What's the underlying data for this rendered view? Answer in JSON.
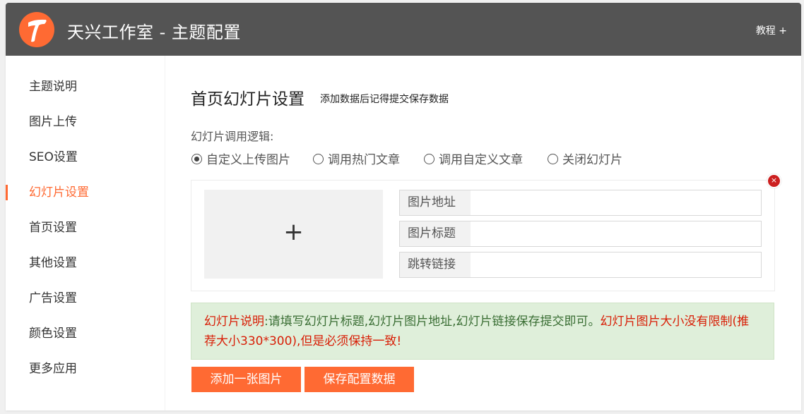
{
  "header": {
    "title": "天兴工作室 - 主题配置",
    "tutorial_label": "教程 +",
    "logo_color": "#ff6a33",
    "bar_color": "#545454"
  },
  "sidebar": {
    "items": [
      {
        "label": "主题说明",
        "active": false
      },
      {
        "label": "图片上传",
        "active": false
      },
      {
        "label": "SEO设置",
        "active": false
      },
      {
        "label": "幻灯片设置",
        "active": true
      },
      {
        "label": "首页设置",
        "active": false
      },
      {
        "label": "其他设置",
        "active": false
      },
      {
        "label": "广告设置",
        "active": false
      },
      {
        "label": "颜色设置",
        "active": false
      },
      {
        "label": "更多应用",
        "active": false
      }
    ]
  },
  "main": {
    "title": "首页幻灯片设置",
    "subtitle": "添加数据后记得提交保存数据",
    "logic_label": "幻灯片调用逻辑:",
    "radios": [
      {
        "label": "自定义上传图片",
        "checked": true
      },
      {
        "label": "调用热门文章",
        "checked": false
      },
      {
        "label": "调用自定义文章",
        "checked": false
      },
      {
        "label": "关闭幻灯片",
        "checked": false
      }
    ],
    "slide": {
      "upload_symbol": "+",
      "remove_symbol": "×",
      "fields": [
        {
          "label": "图片地址",
          "value": ""
        },
        {
          "label": "图片标题",
          "value": ""
        },
        {
          "label": "跳转链接",
          "value": ""
        }
      ]
    },
    "notice": {
      "lead": "幻灯片说明",
      "body": ":请填写幻灯片标题,幻灯片图片地址,幻灯片链接保存提交即可。",
      "warning": "幻灯片图片大小没有限制(推荐大小330*300),但是必须保持一致!"
    },
    "buttons": {
      "add": "添加一张图片",
      "save": "保存配置数据"
    },
    "accent_color": "#ff6a33"
  }
}
